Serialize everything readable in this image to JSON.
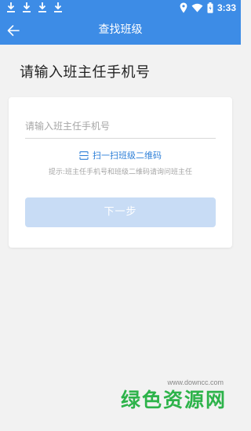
{
  "status_bar": {
    "time": "3:33",
    "notifications": [
      "download-icon",
      "download-icon",
      "download-icon",
      "download-icon"
    ]
  },
  "app_bar": {
    "title": "查找班级",
    "back_icon": "arrow-left-icon"
  },
  "page": {
    "heading": "请输入班主任手机号"
  },
  "form": {
    "phone_placeholder": "请输入班主任手机号",
    "phone_value": "",
    "scan_label": "扫一扫班级二维码",
    "hint": "提示:班主任手机号和班级二维码请询问班主任",
    "next_label": "下一步"
  },
  "watermark": {
    "logo": "绿色资源网",
    "url": "www.downcc.com"
  },
  "colors": {
    "primary": "#3d8ce6",
    "button_disabled": "#c8dcf5",
    "link": "#2d7fd8",
    "watermark": "#2db34a"
  }
}
